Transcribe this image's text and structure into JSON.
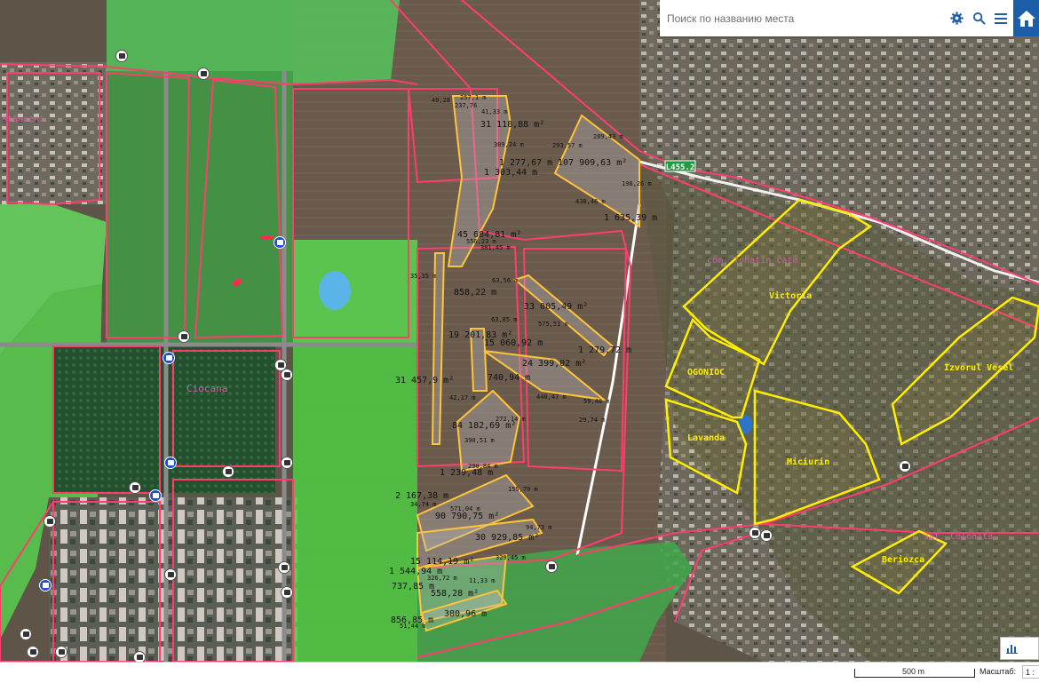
{
  "search": {
    "placeholder": "Поиск по названию места"
  },
  "toolbar": {
    "settings_icon": "gear-icon",
    "search_icon": "search-icon",
    "menu_icon": "menu-icon",
    "home_icon": "home-icon"
  },
  "colors": {
    "boundary": "#ff3d6e",
    "parcel": "#ffc43a",
    "settlement": "#ffee00",
    "road_label_bg": "#1f9a3c",
    "green_zone": "#5ce05c",
    "water": "#5bb4e8"
  },
  "road_label": "L455.2",
  "places": {
    "stauceni": "Stăuceni",
    "ciocana": "Ciocana",
    "tohatin": "com. Tohatin_cata",
    "victoria": "Victoria",
    "ogonioc": "OGONIOC",
    "lavanda": "Lavanda",
    "miciurin": "Miciurin",
    "izvorul": "Izvorul Vesel",
    "colonita": "sat. Colonita",
    "beriozca": "Beriozca"
  },
  "parcel_labels": {
    "a1": "31 118,88 m²",
    "a2": "1 277,67 m",
    "a3": "107 909,63 m²",
    "a4": "1 303,44 m",
    "a5": "45 684,81 m²",
    "a6": "858,22 m",
    "a7": "33 005,49 m²",
    "a8": "19 201,83 m²",
    "a9": "1 279,72 m",
    "a10": "15 060,92 m",
    "a11": "24 399,02 m²",
    "a12": "31 457,9 m²",
    "a13": "740,94 m",
    "a14": "84 182,69 m²",
    "a15": "1 239,48 m",
    "a16": "2 167,38 m",
    "a17": "90 790,75 m²",
    "a18": "30 929,85 m²",
    "a19": "15 114,19 m²",
    "a20": "1 544,94 m",
    "a21": "737,85 m",
    "a22": "558,28 m²",
    "a23": "380,96 m",
    "a24": "856,85 m",
    "a25": "1 635,39 m"
  },
  "edge_labels": {
    "e1": "40,28",
    "e2": "257,1 m",
    "e3": "237,76",
    "e4": "41,33 m",
    "e5": "309,24 m",
    "e6": "293,57 m",
    "e7": "289,43 m",
    "e8": "198,26 m",
    "e9": "438,46 m",
    "e10": "556,23 m",
    "e11": "381,45 m",
    "e12": "35,35 m",
    "e13": "63,56 m",
    "e14": "575,51 m",
    "e15": "63,85 m",
    "e16": "42,17 m",
    "e17": "272,14 m",
    "e18": "390,51 m",
    "e19": "290,84 m",
    "e20": "155,79 m",
    "e21": "34,74 m",
    "e22": "571,04 m",
    "e23": "94,73 m",
    "e24": "329,45 m",
    "e25": "326,72 m",
    "e26": "11,33 m",
    "e27": "51,44 m",
    "e28": "440,47 m",
    "e29": "29,74 m",
    "e30": "59,48 m"
  },
  "scale": {
    "distance": "500 m",
    "title": "Масштаб:",
    "ratio": "1 :"
  }
}
